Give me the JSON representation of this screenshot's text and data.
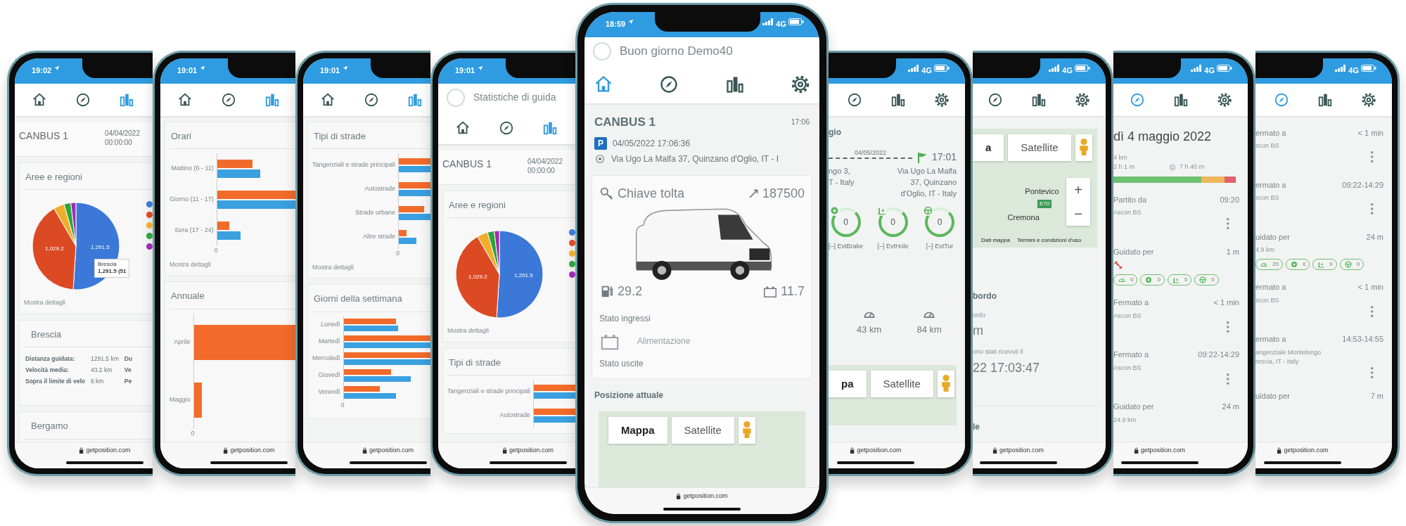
{
  "phones": [
    {
      "kind": "left",
      "status": {
        "time": "19:02"
      },
      "nav": [
        {
          "kind": "home",
          "selected": false
        },
        {
          "kind": "compass",
          "selected": false
        },
        {
          "kind": "chart",
          "selected": true
        }
      ],
      "sections": [
        {
          "kind": "vehicle_header",
          "title": "CANBUS 1",
          "date": "04/04/2022",
          "time": "00:00:00"
        },
        {
          "kind": "card",
          "title": "Aree e regioni",
          "items": [
            {
              "kind": "pie",
              "slice_labels": [
                "1,029.2",
                "1,291.5"
              ],
              "legend": [
                {
                  "color": "#3b78d8"
                },
                {
                  "color": "#dc4a24"
                },
                {
                  "color": "#f0ad2c"
                },
                {
                  "color": "#2aa53b"
                },
                {
                  "color": "#a12bb5"
                }
              ],
              "tooltip": {
                "title": "Brescia",
                "value": "1,291.5 (51"
              }
            },
            {
              "kind": "link",
              "text": "Mostra dettagli"
            }
          ]
        },
        {
          "kind": "card",
          "title": "Brescia",
          "items": [
            {
              "kind": "stats",
              "rows": [
                {
                  "label": "Distanza guidata:",
                  "value": "1291.5 km",
                  "extra": "Du"
                },
                {
                  "label": "Velocità media:",
                  "value": "43.2 km",
                  "extra": "Ve"
                },
                {
                  "label": "Sopra il limite di velo",
                  "value": "6 km",
                  "extra": "Pe"
                }
              ]
            }
          ]
        },
        {
          "kind": "card",
          "title": "Bergamo"
        }
      ],
      "url": "getposition.com"
    },
    {
      "kind": "left",
      "status": {
        "time": "19:01"
      },
      "nav": [
        {
          "kind": "home",
          "selected": false
        },
        {
          "kind": "compass",
          "selected": false
        },
        {
          "kind": "chart",
          "selected": true
        }
      ],
      "sections": [
        {
          "kind": "card",
          "title": "Orari",
          "items": [
            {
              "kind": "bars_hours",
              "rows": [
                {
                  "label": "Mattino (6 - 11)"
                },
                {
                  "label": "Giorno (11 - 17)"
                },
                {
                  "label": "Sera (17 - 24)"
                }
              ],
              "tick": "0"
            },
            {
              "kind": "link",
              "text": "Mostra dettagli"
            }
          ]
        },
        {
          "kind": "card",
          "title": "Annuale",
          "items": [
            {
              "kind": "bars_annual",
              "rows": [
                {
                  "label": "Aprile"
                },
                {
                  "label": "Maggio"
                }
              ],
              "tick": "0"
            }
          ]
        }
      ],
      "url": "getposition.com"
    },
    {
      "kind": "left",
      "status": {
        "time": "19:01"
      },
      "nav": [
        {
          "kind": "home",
          "selected": false
        },
        {
          "kind": "compass",
          "selected": false
        },
        {
          "kind": "chart",
          "selected": true
        }
      ],
      "sections": [
        {
          "kind": "card",
          "title": "Tipi di strade",
          "items": [
            {
              "kind": "bars_roads",
              "rows": [
                {
                  "label": "Tangenziali e strade principali"
                },
                {
                  "label": "Autostrade"
                },
                {
                  "label": "Strade urbane"
                },
                {
                  "label": "Altre strade"
                }
              ],
              "tick": "0"
            },
            {
              "kind": "link",
              "text": "Mostra dettagli"
            }
          ]
        },
        {
          "kind": "card",
          "title": "Giorni della settimana",
          "items": [
            {
              "kind": "bars_weekdays",
              "rows": [
                {
                  "label": "Lunedì"
                },
                {
                  "label": "Martedì"
                },
                {
                  "label": "Mercoledì"
                },
                {
                  "label": "Giovedì"
                },
                {
                  "label": "Venerdì"
                }
              ],
              "tick": "0"
            }
          ]
        }
      ],
      "url": "getposition.com"
    },
    {
      "kind": "left",
      "status": {
        "time": "19:01"
      },
      "top_bar": {
        "title": "Statistiche di guida"
      },
      "nav": [
        {
          "kind": "home",
          "selected": false
        },
        {
          "kind": "compass",
          "selected": false
        },
        {
          "kind": "chart",
          "selected": true
        }
      ],
      "sections": [
        {
          "kind": "vehicle_header",
          "title": "CANBUS 1",
          "date": "04/04/2022",
          "time": "00:00:00"
        },
        {
          "kind": "card",
          "title": "Aree e regioni",
          "items": [
            {
              "kind": "pie",
              "slice_labels": [
                "1,029.2",
                "1,291.5"
              ],
              "legend": [
                {
                  "color": "#3b78d8"
                },
                {
                  "color": "#dc4a24"
                },
                {
                  "color": "#f0ad2c"
                },
                {
                  "color": "#2aa53b"
                },
                {
                  "color": "#a12bb5"
                }
              ]
            },
            {
              "kind": "link",
              "text": "Mostra dettagli"
            }
          ]
        },
        {
          "kind": "card",
          "title": "Tipi di strade",
          "items": [
            {
              "kind": "bars_roads",
              "rows": [
                {
                  "label": "Tangenziali e strade principali"
                },
                {
                  "label": "Autostrade"
                }
              ]
            }
          ]
        }
      ],
      "url": "getposition.com"
    },
    {
      "kind": "center",
      "status": {
        "time": "18:59",
        "network": "4G"
      },
      "top_bar": {
        "title": "Buon giorno Demo40"
      },
      "nav": [
        {
          "kind": "home",
          "selected": true
        },
        {
          "kind": "compass",
          "selected": false
        },
        {
          "kind": "chart",
          "selected": false
        },
        {
          "kind": "settings",
          "selected": false
        }
      ],
      "sections": [
        {
          "kind": "vehicle_status",
          "title": "CANBUS 1",
          "time": "17:06",
          "badge": "P",
          "datetime": "04/05/2022 17:06:36",
          "address": "Via Ugo La Malfa 37, Quinzano d'Oglio, IT - I"
        },
        {
          "kind": "vehicle_card",
          "ignition": "Chiave tolta",
          "odometer": "187500",
          "fuel": "29.2",
          "battery": "11.7",
          "inputs_title": "Stato ingressi",
          "inputs": [
            {
              "label": "Alimentazione",
              "on": false
            }
          ],
          "outputs_title": "Stato uscite"
        },
        {
          "kind": "position",
          "title": "Posizione attuale",
          "map": {
            "buttons": [
              {
                "label": "Mappa",
                "selected": true
              },
              {
                "label": "Satellite",
                "selected": false
              }
            ]
          }
        }
      ],
      "url": "getposition.com"
    },
    {
      "kind": "right",
      "status": {
        "network": "4G"
      },
      "nav": [
        {
          "kind": "compass",
          "selected": false
        },
        {
          "kind": "chart",
          "selected": false
        },
        {
          "kind": "settings",
          "selected": false
        }
      ],
      "sections": [
        {
          "kind": "trip",
          "heading": "gio",
          "date": "04/05/2022",
          "end_time": "17:01",
          "start_lines": [
            "ngo 3,",
            "T - Italy"
          ],
          "end_lines": [
            "Via Ugo La Malfa",
            "37, Quinzano",
            "d'Oglio, IT - Italy"
          ]
        },
        {
          "kind": "events",
          "items": [
            {
              "kind": "brake",
              "value": "0",
              "label": "[–] EvtBrake"
            },
            {
              "kind": "hole",
              "value": "0",
              "label": "[–] EvtHole"
            },
            {
              "kind": "turn",
              "value": "0",
              "label": "[–] EvtTur"
            }
          ]
        },
        {
          "kind": "speeds",
          "items": [
            {
              "value": "43 km"
            },
            {
              "value": "84 km"
            }
          ]
        },
        {
          "kind": "map",
          "map": {
            "buttons": [
              {
                "label": "pa",
                "selected": true
              },
              {
                "label": "Satellite",
                "selected": false
              }
            ]
          }
        }
      ],
      "url": "getposition.com"
    },
    {
      "kind": "right",
      "status": {
        "network": "4G"
      },
      "nav": [
        {
          "kind": "compass",
          "selected": false
        },
        {
          "kind": "chart",
          "selected": false
        },
        {
          "kind": "settings",
          "selected": false
        }
      ],
      "sections": [
        {
          "kind": "map",
          "map": {
            "buttons": [
              {
                "label": "a",
                "selected": true
              },
              {
                "label": "Satellite",
                "selected": false
              }
            ],
            "places": [
              "Pontevico",
              "Cremona"
            ],
            "road": "E70",
            "zoom": [
              "+",
              "−"
            ],
            "attribution": [
              "Dati mappa",
              "Termini e condizioni d'uso"
            ]
          }
        },
        {
          "kind": "text_block",
          "lines": [
            {
              "kind": "heading",
              "text": "bordo"
            },
            {
              "kind": "caption",
              "text": "ordo"
            },
            {
              "kind": "value",
              "text": "m"
            },
            {
              "kind": "caption",
              "text": "ono stati ricevuti il"
            },
            {
              "kind": "value",
              "text": "22 17:03:47"
            }
          ]
        },
        {
          "kind": "text_block",
          "lines": [
            {
              "kind": "heading",
              "text": "le"
            }
          ]
        }
      ],
      "url": "getposition.com"
    },
    {
      "kind": "right",
      "status": {
        "network": "4G"
      },
      "nav": [
        {
          "kind": "compass",
          "selected": true
        },
        {
          "kind": "chart",
          "selected": false
        },
        {
          "kind": "settings",
          "selected": false
        }
      ],
      "sections": [
        {
          "kind": "day_summary",
          "title": "dì 4 maggio 2022",
          "distance": "4 km",
          "duration": "2 h 1 m",
          "stopped": "7 h 40 m"
        },
        {
          "kind": "timeline",
          "entries": [
            {
              "kind": "stop",
              "title": "Partito da",
              "time": "09:20",
              "place": [
                "Ascon BS"
              ]
            },
            {
              "kind": "drive",
              "title": "Guidato per",
              "time": "1 m",
              "alert": true,
              "chips": [
                {
                  "kind": "speed",
                  "value": "0"
                },
                {
                  "kind": "brake",
                  "value": "0"
                },
                {
                  "kind": "hole",
                  "value": "0"
                },
                {
                  "kind": "turn",
                  "value": "0"
                }
              ]
            },
            {
              "kind": "stop",
              "title": "Fermato a",
              "time": "< 1 min",
              "place": [
                "Ascon BS"
              ]
            },
            {
              "kind": "stop",
              "title": "Fermato a",
              "time": "09:22-14:29",
              "place": [
                "Ascon BS"
              ]
            },
            {
              "kind": "drive",
              "title": "Guidato per",
              "time": "24 m",
              "distance": "24.9 km",
              "alert": false
            }
          ]
        }
      ],
      "url": "getposition.com"
    },
    {
      "kind": "right",
      "status": {
        "network": "4G"
      },
      "nav": [
        {
          "kind": "compass",
          "selected": true
        },
        {
          "kind": "chart",
          "selected": false
        },
        {
          "kind": "settings",
          "selected": false
        }
      ],
      "sections": [
        {
          "kind": "timeline",
          "entries": [
            {
              "kind": "stop",
              "title": "ermato a",
              "time": "< 1 min",
              "place": [
                "scon BS"
              ]
            },
            {
              "kind": "stop",
              "title": "ermato a",
              "time": "09:22-14:29",
              "place": [
                "scon BS"
              ]
            },
            {
              "kind": "drive",
              "title": "uidato per",
              "time": "24 m",
              "distance": "4.9 km",
              "alert": false,
              "chips": [
                {
                  "kind": "speed",
                  "value": "20"
                },
                {
                  "kind": "brake",
                  "value": "0"
                },
                {
                  "kind": "hole",
                  "value": "0"
                },
                {
                  "kind": "turn",
                  "value": "0"
                }
              ]
            },
            {
              "kind": "stop",
              "title": "ermato a",
              "time": "< 1 min",
              "place": [
                "scon BS"
              ]
            },
            {
              "kind": "stop",
              "title": "ermato a",
              "time": "14:53-14:55",
              "place": [
                "angenziale Montelungo",
                "rescia, IT - Italy"
              ]
            },
            {
              "kind": "drive",
              "title": "uidato per",
              "time": "7 m",
              "alert": false
            }
          ]
        }
      ],
      "url": "getposition.com"
    }
  ]
}
